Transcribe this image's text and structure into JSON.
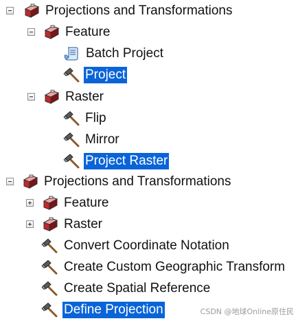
{
  "tree": {
    "rows": [
      {
        "label": "Projections and Transformations",
        "icon": "toolbox-icon",
        "expander": "minus",
        "selected": false
      },
      {
        "label": "Feature",
        "icon": "toolbox-icon",
        "expander": "minus",
        "selected": false
      },
      {
        "label": "Batch Project",
        "icon": "script-icon",
        "expander": null,
        "selected": false
      },
      {
        "label": "Project",
        "icon": "hammer-icon",
        "expander": null,
        "selected": true
      },
      {
        "label": "Raster",
        "icon": "toolbox-icon",
        "expander": "minus",
        "selected": false
      },
      {
        "label": "Flip",
        "icon": "hammer-icon",
        "expander": null,
        "selected": false
      },
      {
        "label": "Mirror",
        "icon": "hammer-icon",
        "expander": null,
        "selected": false
      },
      {
        "label": "Project Raster",
        "icon": "hammer-icon",
        "expander": null,
        "selected": true
      },
      {
        "label": "Projections and Transformations",
        "icon": "toolbox-icon",
        "expander": "minus",
        "selected": false
      },
      {
        "label": "Feature",
        "icon": "toolbox-icon",
        "expander": "plus",
        "selected": false
      },
      {
        "label": "Raster",
        "icon": "toolbox-icon",
        "expander": "plus",
        "selected": false
      },
      {
        "label": "Convert Coordinate Notation",
        "icon": "hammer-icon",
        "expander": null,
        "selected": false
      },
      {
        "label": "Create Custom Geographic Transform",
        "icon": "hammer-icon",
        "expander": null,
        "selected": false
      },
      {
        "label": "Create Spatial Reference",
        "icon": "hammer-icon",
        "expander": null,
        "selected": false
      },
      {
        "label": "Define Projection",
        "icon": "hammer-icon",
        "expander": null,
        "selected": true
      }
    ]
  },
  "watermark": "CSDN @地球Online原住民",
  "colors": {
    "selection": "#0a64d8",
    "toolbox_red": "#c0282a",
    "hammer_handle": "#8a5a2b"
  }
}
